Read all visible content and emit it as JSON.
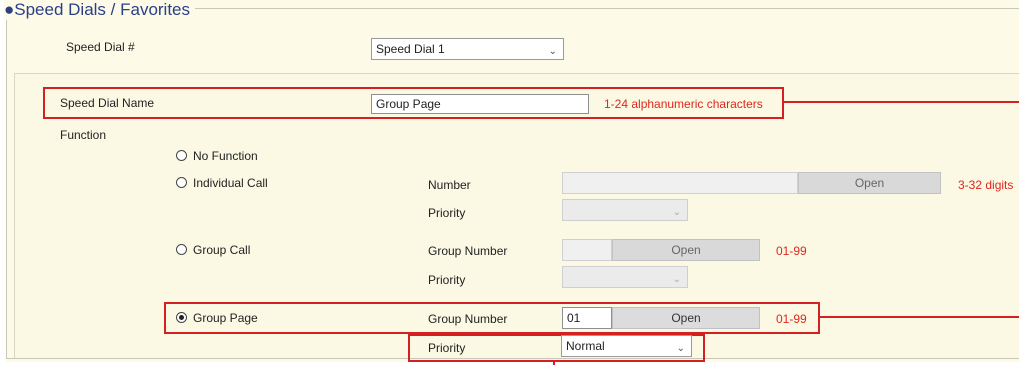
{
  "section": {
    "title": "●Speed Dials / Favorites"
  },
  "speed_dial_number": {
    "label": "Speed Dial #",
    "value": "Speed Dial 1"
  },
  "speed_dial_name": {
    "label": "Speed Dial Name",
    "value": "Group Page",
    "hint": "1-24 alphanumeric characters"
  },
  "function": {
    "label": "Function",
    "options": {
      "no_function": {
        "label": "No Function",
        "selected": false
      },
      "individual_call": {
        "label": "Individual Call",
        "selected": false,
        "number_label": "Number",
        "number_value": "",
        "open_label": "Open",
        "number_hint": "3-32 digits",
        "priority_label": "Priority",
        "priority_value": ""
      },
      "group_call": {
        "label": "Group Call",
        "selected": false,
        "group_number_label": "Group Number",
        "group_number_value": "",
        "open_label": "Open",
        "range_hint": "01-99",
        "priority_label": "Priority",
        "priority_value": ""
      },
      "group_page": {
        "label": "Group Page",
        "selected": true,
        "group_number_label": "Group Number",
        "group_number_value": "01",
        "open_label": "Open",
        "range_hint": "01-99",
        "priority_label": "Priority",
        "priority_value": "Normal"
      }
    }
  },
  "colors": {
    "title_blue": "#2a3f86",
    "hint_red": "#e0261f",
    "annotation_red": "#d42020",
    "panel_bg": "#fdfbe8"
  }
}
